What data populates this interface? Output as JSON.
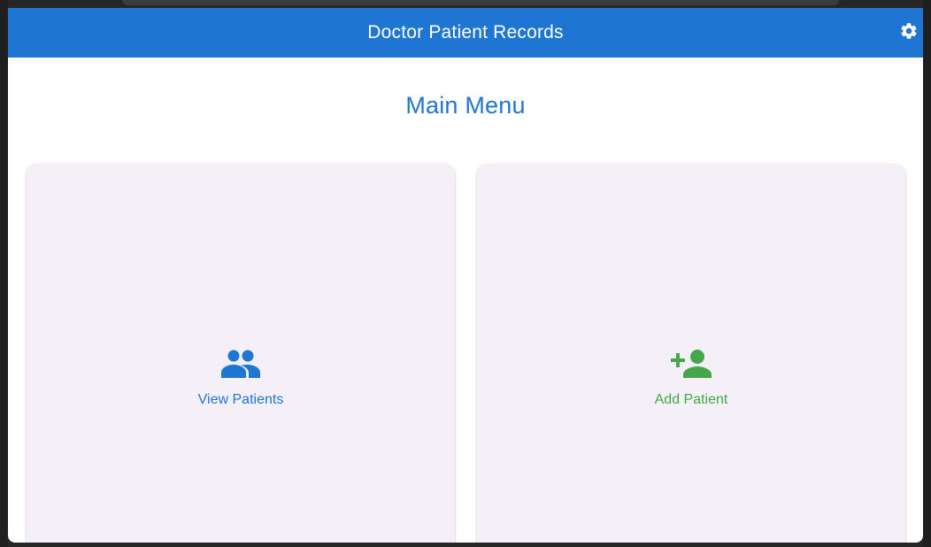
{
  "appbar": {
    "title": "Doctor Patient Records",
    "settings_icon": "gear-icon"
  },
  "main": {
    "title": "Main Menu",
    "cards": [
      {
        "label": "View Patients",
        "icon": "people-icon",
        "color": "#1f76d2"
      },
      {
        "label": "Add Patient",
        "icon": "person-add-icon",
        "color": "#44a84a"
      }
    ]
  },
  "colors": {
    "primary": "#1f76d2",
    "success": "#44a84a",
    "card_background": "#f5f0f8"
  }
}
